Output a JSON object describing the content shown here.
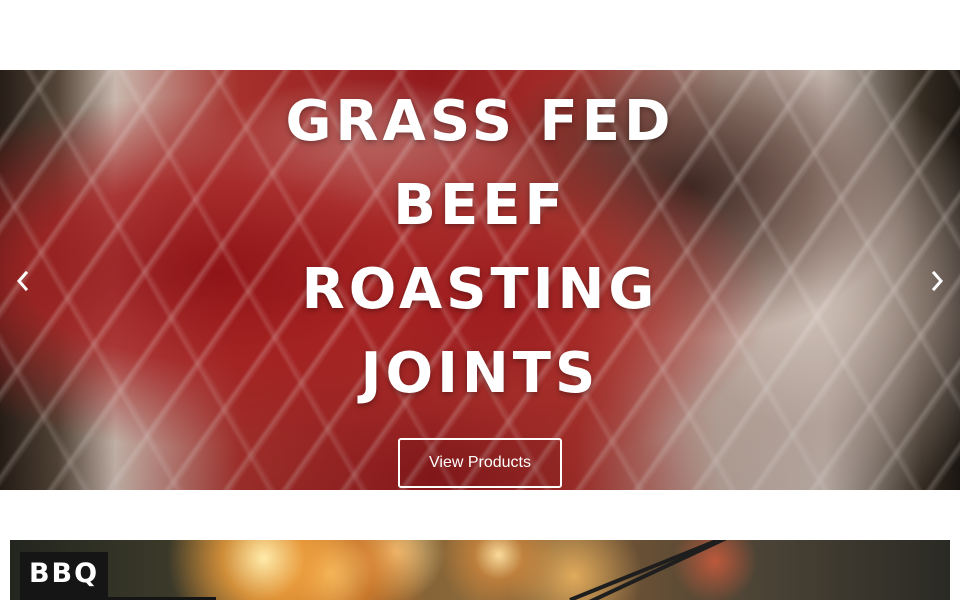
{
  "hero": {
    "title_lines": [
      "GRASS FED",
      "BEEF",
      "ROASTING",
      "JOINTS"
    ],
    "button_label": "View Products",
    "prev_icon": "chevron-left-icon",
    "next_icon": "chevron-right-icon"
  },
  "bbq_card": {
    "label": "BBQ"
  },
  "colors": {
    "background": "#ffffff",
    "text": "#ffffff",
    "label_bg": "#151515"
  }
}
